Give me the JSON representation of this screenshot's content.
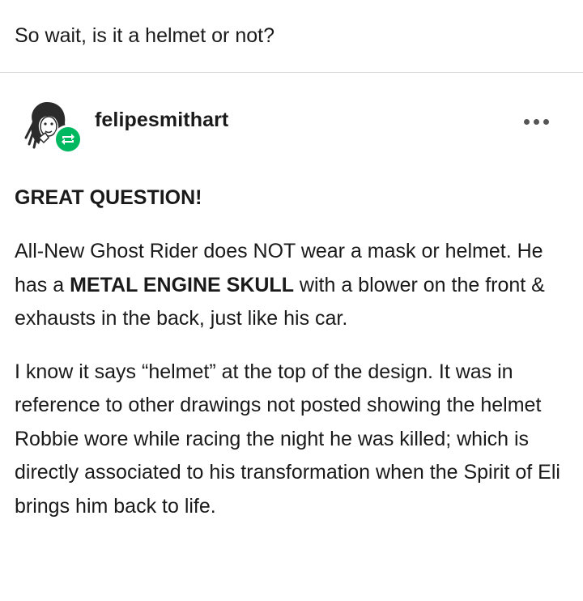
{
  "question": "So wait, is it a helmet or not?",
  "post": {
    "username": "felipesmithart",
    "more_icon": "more-horizontal-icon",
    "badge_icon": "reblog-icon",
    "badge_color": "#00b85f",
    "heading": "GREAT QUESTION!",
    "paragraph1": {
      "part1": "All-New Ghost Rider does NOT wear a mask or helmet. He has a ",
      "bold": "METAL ENGINE SKULL",
      "part2": " with a blower on the front & exhausts in the back, just like his car."
    },
    "paragraph2": "I know it says “helmet” at the top of the design. It was in reference to other drawings not posted showing the helmet Robbie wore while racing the night he was killed; which is directly associated to his transformation when the Spirit of Eli brings him back to life."
  }
}
